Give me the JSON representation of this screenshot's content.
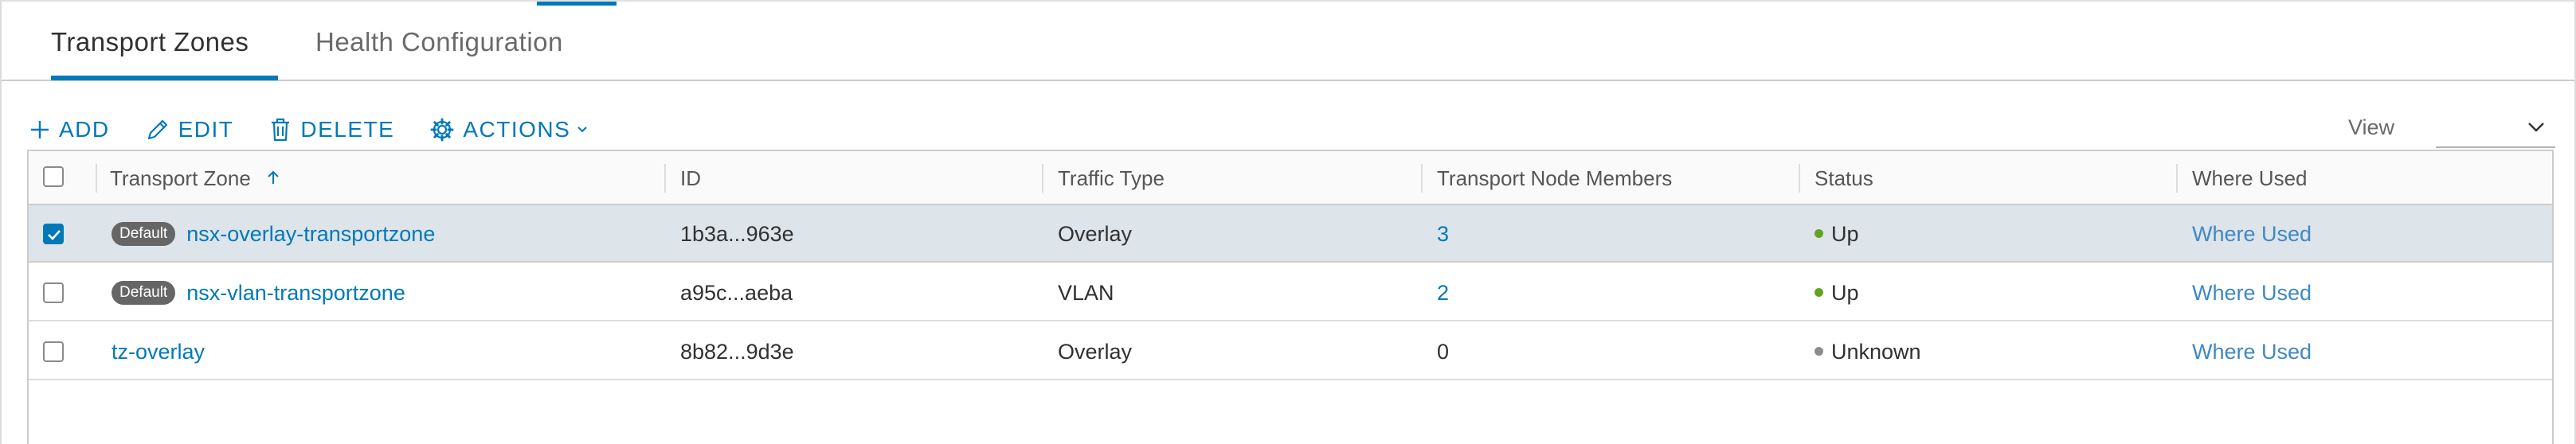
{
  "tabs": [
    {
      "label": "Transport Zones",
      "active": true
    },
    {
      "label": "Health Configuration",
      "active": false
    }
  ],
  "toolbar": {
    "add": "ADD",
    "edit": "EDIT",
    "delete": "DELETE",
    "actions": "ACTIONS"
  },
  "view": {
    "label": "View",
    "value": ""
  },
  "table": {
    "columns": [
      "Transport Zone",
      "ID",
      "Traffic Type",
      "Transport Node Members",
      "Status",
      "Where Used"
    ],
    "sort_column": "Transport Zone",
    "sort_direction": "ascending",
    "rows": [
      {
        "selected": true,
        "badge": "Default",
        "name": "nsx-overlay-transportzone",
        "id": "1b3a...963e",
        "traffic_type": "Overlay",
        "members": "3",
        "status": "Up",
        "where_used": "Where Used"
      },
      {
        "selected": false,
        "badge": "Default",
        "name": "nsx-vlan-transportzone",
        "id": "a95c...aeba",
        "traffic_type": "VLAN",
        "members": "2",
        "status": "Up",
        "where_used": "Where Used"
      },
      {
        "selected": false,
        "badge": "",
        "name": "tz-overlay",
        "id": "8b82...9d3e",
        "traffic_type": "Overlay",
        "members": "0",
        "status": "Unknown",
        "where_used": "Where Used"
      }
    ]
  },
  "colors": {
    "accent": "#0079b8",
    "status_up": "#62a420",
    "status_unknown": "#8c8c8c",
    "badge": "#666666",
    "selected_row": "#dde4ea"
  }
}
